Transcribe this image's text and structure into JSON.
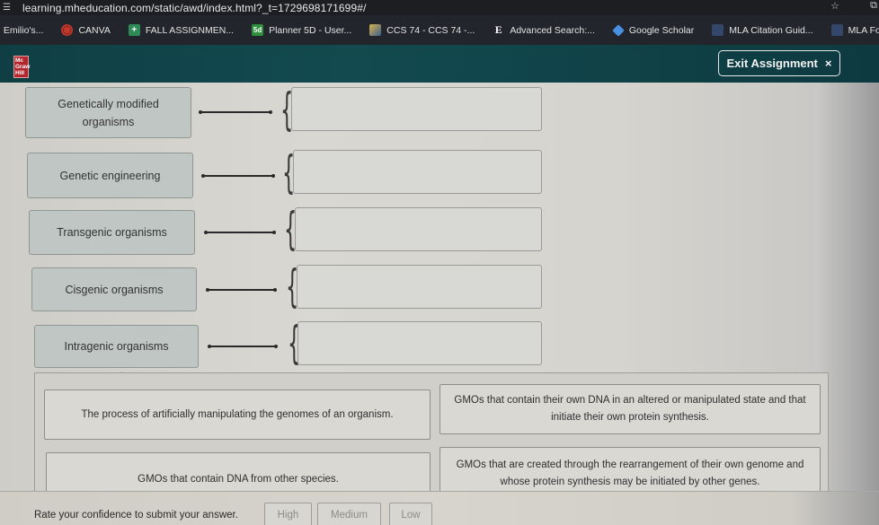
{
  "browser": {
    "url": "learning.mheducation.com/static/awd/index.html?_t=1729698171699#/",
    "bookmarks": [
      {
        "label": ": Emilio's...",
        "icon": "none"
      },
      {
        "label": "CANVA",
        "icon": "canva-icon"
      },
      {
        "label": "FALL ASSIGNMEN...",
        "icon": "plus-icon"
      },
      {
        "label": "Planner 5D - User...",
        "icon": "planner5d-icon"
      },
      {
        "label": "CCS 74 - CCS 74 -...",
        "icon": "ccs-icon"
      },
      {
        "label": "Advanced Search:...",
        "icon": "e-icon"
      },
      {
        "label": "Google Scholar",
        "icon": "google-scholar-icon"
      },
      {
        "label": "MLA Citation Guid...",
        "icon": "doc-icon"
      },
      {
        "label": "MLA Formatting G...",
        "icon": "doc-icon"
      }
    ]
  },
  "header": {
    "logo_lines": [
      "Mc",
      "Graw",
      "Hill"
    ],
    "exit_label": "Exit Assignment",
    "exit_icon": "×",
    "bg_color": "#124a50",
    "logo_color": "#b3262d"
  },
  "matching": {
    "terms": [
      {
        "label": "Genetically modified organisms",
        "line1": "Genetically modified",
        "line2": "organisms"
      },
      {
        "label": "Genetic engineering"
      },
      {
        "label": "Transgenic organisms"
      },
      {
        "label": "Cisgenic organisms"
      },
      {
        "label": "Intragenic organisms"
      }
    ],
    "dropzones": [
      "",
      "",
      "",
      "",
      ""
    ],
    "answers": [
      "The process of artificially manipulating the genomes of an organism.",
      "GMOs that contain their own DNA in an altered or manipulated state and that initiate their own protein synthesis.",
      "GMOs that contain DNA from other species.",
      "GMOs that are created through the rearrangement of their own genome and whose protein synthesis may be initiated by other genes."
    ]
  },
  "footer": {
    "prompt": "Rate your confidence to submit your answer.",
    "buttons": [
      "High",
      "Medium",
      "Low"
    ]
  }
}
